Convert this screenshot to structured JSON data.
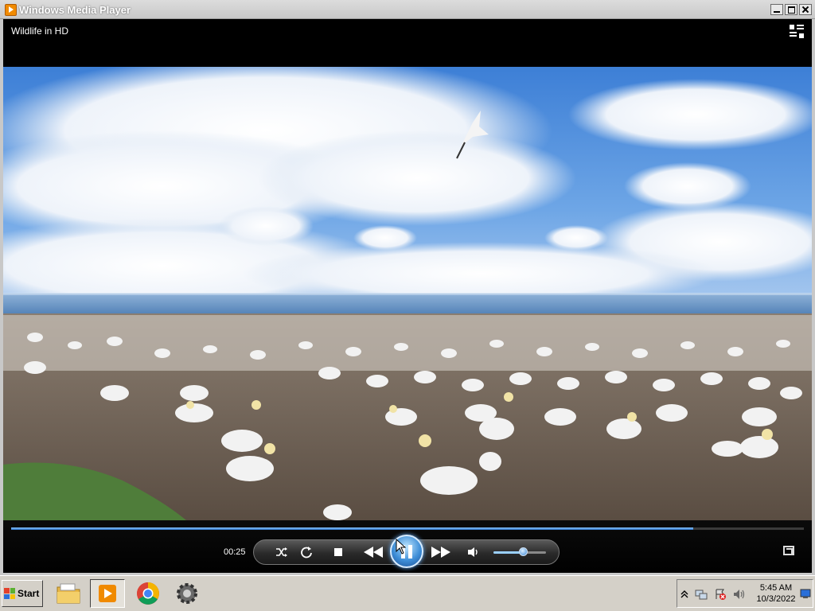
{
  "window": {
    "title": "Windows Media Player"
  },
  "now_playing": {
    "media_title": "Wildlife in HD"
  },
  "player": {
    "elapsed_time": "00:25",
    "seek_progress": 0.86,
    "volume_level": 0.56,
    "state": "playing"
  },
  "icons": {
    "app": "media-player-icon",
    "switch_to_library": "switch-to-library-icon",
    "shuffle": "shuffle-icon",
    "repeat": "repeat-icon",
    "stop": "stop-icon",
    "previous": "previous-icon",
    "play_pause": "pause-icon",
    "next": "next-icon",
    "mute": "speaker-icon",
    "fullscreen": "fullscreen-icon"
  },
  "taskbar": {
    "start_label": "Start",
    "apps": [
      "File Explorer",
      "Windows Media Player",
      "Google Chrome",
      "Settings"
    ],
    "clock_time": "5:45 AM",
    "clock_date": "10/3/2022"
  },
  "colors": {
    "accent": "#3f8fd8",
    "taskbar": "#d4d0c8"
  }
}
